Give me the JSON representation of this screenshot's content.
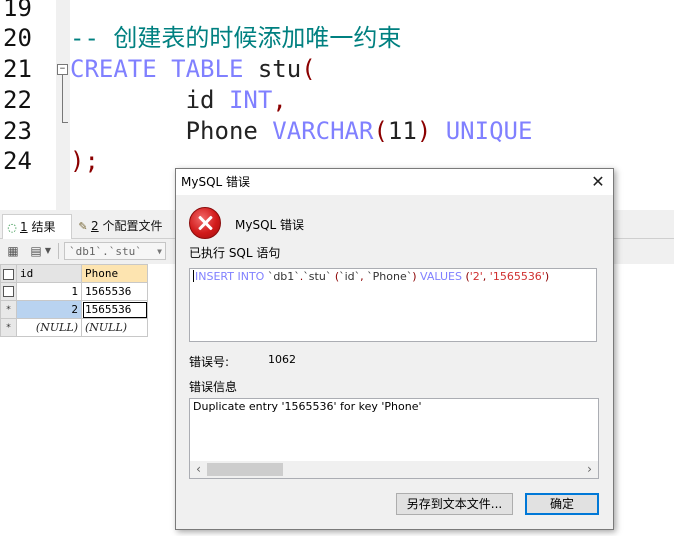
{
  "editor": {
    "line_numbers": [
      "19",
      "20",
      "21",
      "22",
      "23",
      "24"
    ],
    "fold_marker": "−",
    "lines": [
      [],
      [
        {
          "t": "-- 创建表的时候添加唯一约束",
          "c": "cmt"
        }
      ],
      [
        {
          "t": "CREATE",
          "c": "kw"
        },
        {
          "t": " ",
          "c": "txt"
        },
        {
          "t": "TABLE",
          "c": "kw"
        },
        {
          "t": " stu",
          "c": "txt"
        },
        {
          "t": "(",
          "c": "par"
        }
      ],
      [
        {
          "t": "        id ",
          "c": "txt"
        },
        {
          "t": "INT",
          "c": "kw"
        },
        {
          "t": ",",
          "c": "par"
        }
      ],
      [
        {
          "t": "        Phone ",
          "c": "txt"
        },
        {
          "t": "VARCHAR",
          "c": "kw"
        },
        {
          "t": "(",
          "c": "par"
        },
        {
          "t": "11",
          "c": "txt"
        },
        {
          "t": ")",
          "c": "par"
        },
        {
          "t": " ",
          "c": "txt"
        },
        {
          "t": "UNIQUE",
          "c": "kw"
        }
      ],
      [
        {
          "t": ");",
          "c": "par"
        }
      ]
    ]
  },
  "results_panel": {
    "tabs": {
      "results_num": "1",
      "results_label": " 结果",
      "profile_num": "2",
      "profile_label": " 个配置文件"
    },
    "toolbar": {
      "table_selector": "`db1`.`stu`"
    },
    "grid": {
      "columns": [
        "id",
        "Phone"
      ],
      "rows": [
        {
          "marker": "checkbox",
          "id": "1",
          "phone": "1565536"
        },
        {
          "marker": "*",
          "id": "2",
          "phone": "1565536"
        },
        {
          "marker": "*",
          "id": "(NULL)",
          "phone": "(NULL)"
        }
      ]
    }
  },
  "dialog": {
    "title": "MySQL 错误",
    "close_glyph": "✕",
    "heading": "MySQL 错误",
    "sql_label": "已执行 SQL 语句",
    "sql_statement": "INSERT INTO `db1`.`stu` (`id`, `Phone`) VALUES ('2', '1565536')",
    "error_number_label": "错误号:",
    "error_number": "1062",
    "error_info_label": "错误信息",
    "error_message": "Duplicate entry '1565536' for key 'Phone'",
    "save_button": "另存到文本文件...",
    "ok_button": "确定"
  },
  "colors": {
    "keyword": "#8080ff",
    "comment": "#008080",
    "paren": "#8b0000",
    "error_icon": "#d11b1b",
    "default_button_border": "#0078d7"
  },
  "icons": [
    "fold-minus-icon",
    "results-icon",
    "profile-icon",
    "grid-icon",
    "export-icon",
    "error-icon",
    "close-icon",
    "chevron-left-icon",
    "chevron-right-icon"
  ]
}
